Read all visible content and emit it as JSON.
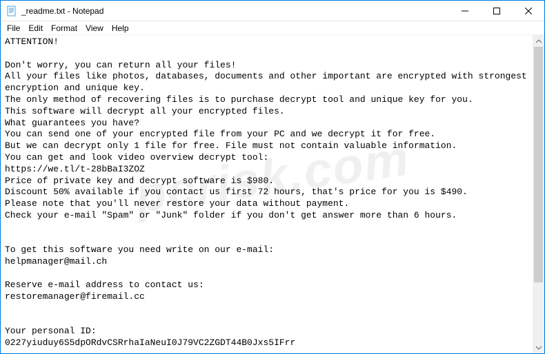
{
  "window": {
    "title": "_readme.txt - Notepad",
    "icon_name": "notepad-icon"
  },
  "menu": {
    "file": "File",
    "edit": "Edit",
    "format": "Format",
    "view": "View",
    "help": "Help"
  },
  "body_text": "ATTENTION!\n\nDon't worry, you can return all your files!\nAll your files like photos, databases, documents and other important are encrypted with strongest encryption and unique key.\nThe only method of recovering files is to purchase decrypt tool and unique key for you.\nThis software will decrypt all your encrypted files.\nWhat guarantees you have?\nYou can send one of your encrypted file from your PC and we decrypt it for free.\nBut we can decrypt only 1 file for free. File must not contain valuable information.\nYou can get and look video overview decrypt tool:\nhttps://we.tl/t-28bBaI3ZOZ\nPrice of private key and decrypt software is $980.\nDiscount 50% available if you contact us first 72 hours, that's price for you is $490.\nPlease note that you'll never restore your data without payment.\nCheck your e-mail \"Spam\" or \"Junk\" folder if you don't get answer more than 6 hours.\n\n\nTo get this software you need write on our e-mail:\nhelpmanager@mail.ch\n\nReserve e-mail address to contact us:\nrestoremanager@firemail.cc\n\n\nYour personal ID:\n0227yiuduy6S5dpORdvCSRrhaIaNeuI0J79VC2ZGDT44B0Jxs5IFrr",
  "watermark": "pcrisk.com"
}
